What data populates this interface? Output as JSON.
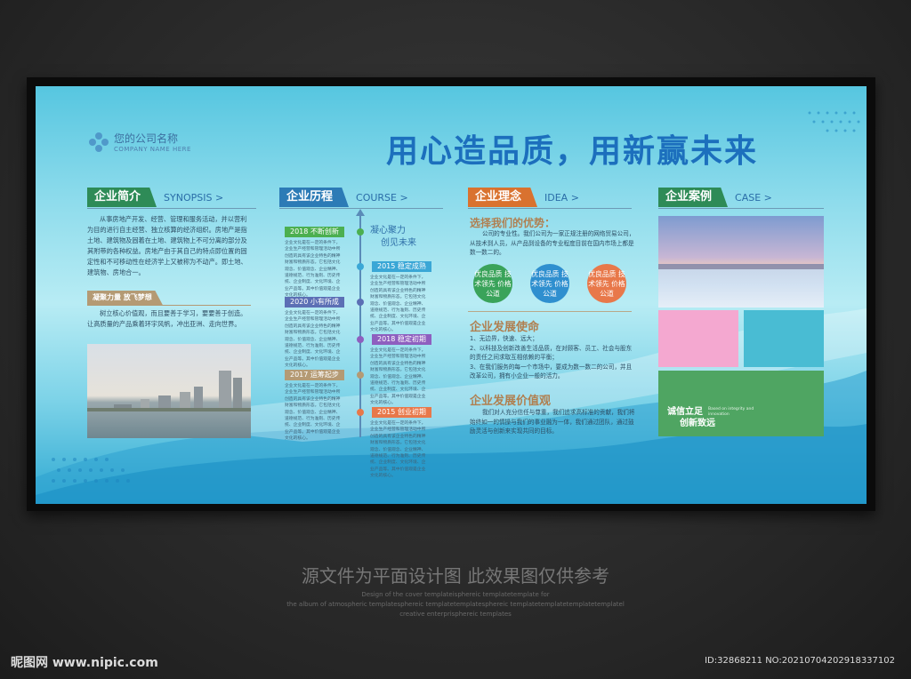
{
  "company": {
    "name": "您的公司名称",
    "sub": "COMPANY NAME HERE"
  },
  "headline": "用心造品质，用新赢未来",
  "sections": {
    "synopsis": {
      "title": "企业简介",
      "en": "SYNOPSIS >",
      "color": "#2e8b57",
      "body": "从事房地产开发、经营、管理和服务活动，并以营利为目的进行自主经营、独立核算的经济组织。房地产是指土地、建筑物及固着在土地、建筑物上不可分离的部分及其附带的各种权益。房地产由于其自己的特点即位置的固定性和不可移动性在经济学上又被称为不动产。即土地、建筑物、房地合一。",
      "sub_title": "凝聚力量 放飞梦想",
      "sub_body": "树立核心价值观，而且要善于学习，要要善于创造。让高质量的产品乘着环宇风帆，冲出亚洲、走向世界。"
    },
    "course": {
      "title": "企业历程",
      "en": "COURSE >",
      "color": "#2c7bb6",
      "slogan1": "凝心聚力",
      "slogan2": "创见未来",
      "items": [
        {
          "label": "2018 不断创新",
          "color": "#4caf50"
        },
        {
          "label": "2015 稳定成熟",
          "color": "#3aa7d6"
        },
        {
          "label": "2020 小有所成",
          "color": "#5c6fb5"
        },
        {
          "label": "2018 稳定初期",
          "color": "#8e5fbf"
        },
        {
          "label": "2017 运筹起步",
          "color": "#b49a74"
        },
        {
          "label": "2015 创业初期",
          "color": "#e8784a"
        }
      ],
      "desc": "企业文化是在一定的条件下，企业生产经营和管理活动中所创造的具有该企业特色的精神财富和物质形态。它包括文化观念、价值观念、企业精神、道德规范、行为准则、历史传统、企业制度、文化环境、企业产品等。其中价值观是企业文化的核心。"
    },
    "idea": {
      "title": "企业理念",
      "en": "IDEA >",
      "color": "#d9722f",
      "h_adv": "选择我们的优势：",
      "adv_body": "公司的专业性。我们公司为一家正规注册的网络贸易公司，从技术到人员，从产品到设备的专业程度目前在国内市场上都是数一数二的。",
      "circles": [
        {
          "text": "优良品质 技术领先 价格公道",
          "color": "#3aa35a"
        },
        {
          "text": "优良品质 技术领先 价格公道",
          "color": "#2f8fcf"
        },
        {
          "text": "优良品质 技术领先 价格公道",
          "color": "#e8784a"
        }
      ],
      "h_mission": "企业发展使命",
      "mission_items": [
        "1、无边界，快速、远大；",
        "2、以科技及创新改善生活品质，在对顾客、员工、社会与股东的责任之间求取互相依赖的平衡；",
        "3、在我们服务的每一个市场中，要成为数一数二的公司，并且改革公司，拥有小企业一般的活力。"
      ],
      "h_value": "企业发展价值观",
      "value_body": "我们对人充分信任与尊重，我们追求高标准的贡献，我们将始终如一的情操与我们的事业融为一体，我们通过团队，通过鼓励灵活与创新来实现共同的目标。"
    },
    "case": {
      "title": "企业案例",
      "en": "CASE >",
      "color": "#2e8b57",
      "green_cn1": "诚信立足",
      "green_cn2": "创新致远",
      "green_en": "Based on integrity and innovation",
      "pink": "#f4a8d0",
      "teal": "#49bcd3",
      "green": "#4fa562"
    }
  },
  "footer": {
    "caption": "源文件为平面设计图 此效果图仅供参考",
    "small1": "Design of the cover templateisphereic templatetemplate for",
    "small2": "the album of atmospheric templatesphereic templatetemplatesphereic templatetemplatetemplatetemplatel",
    "small3": "creative enterprisphereic templates",
    "watermark": "昵图网 www.nipic.com",
    "id": "ID:32868211 NO:20210704202918337102"
  }
}
